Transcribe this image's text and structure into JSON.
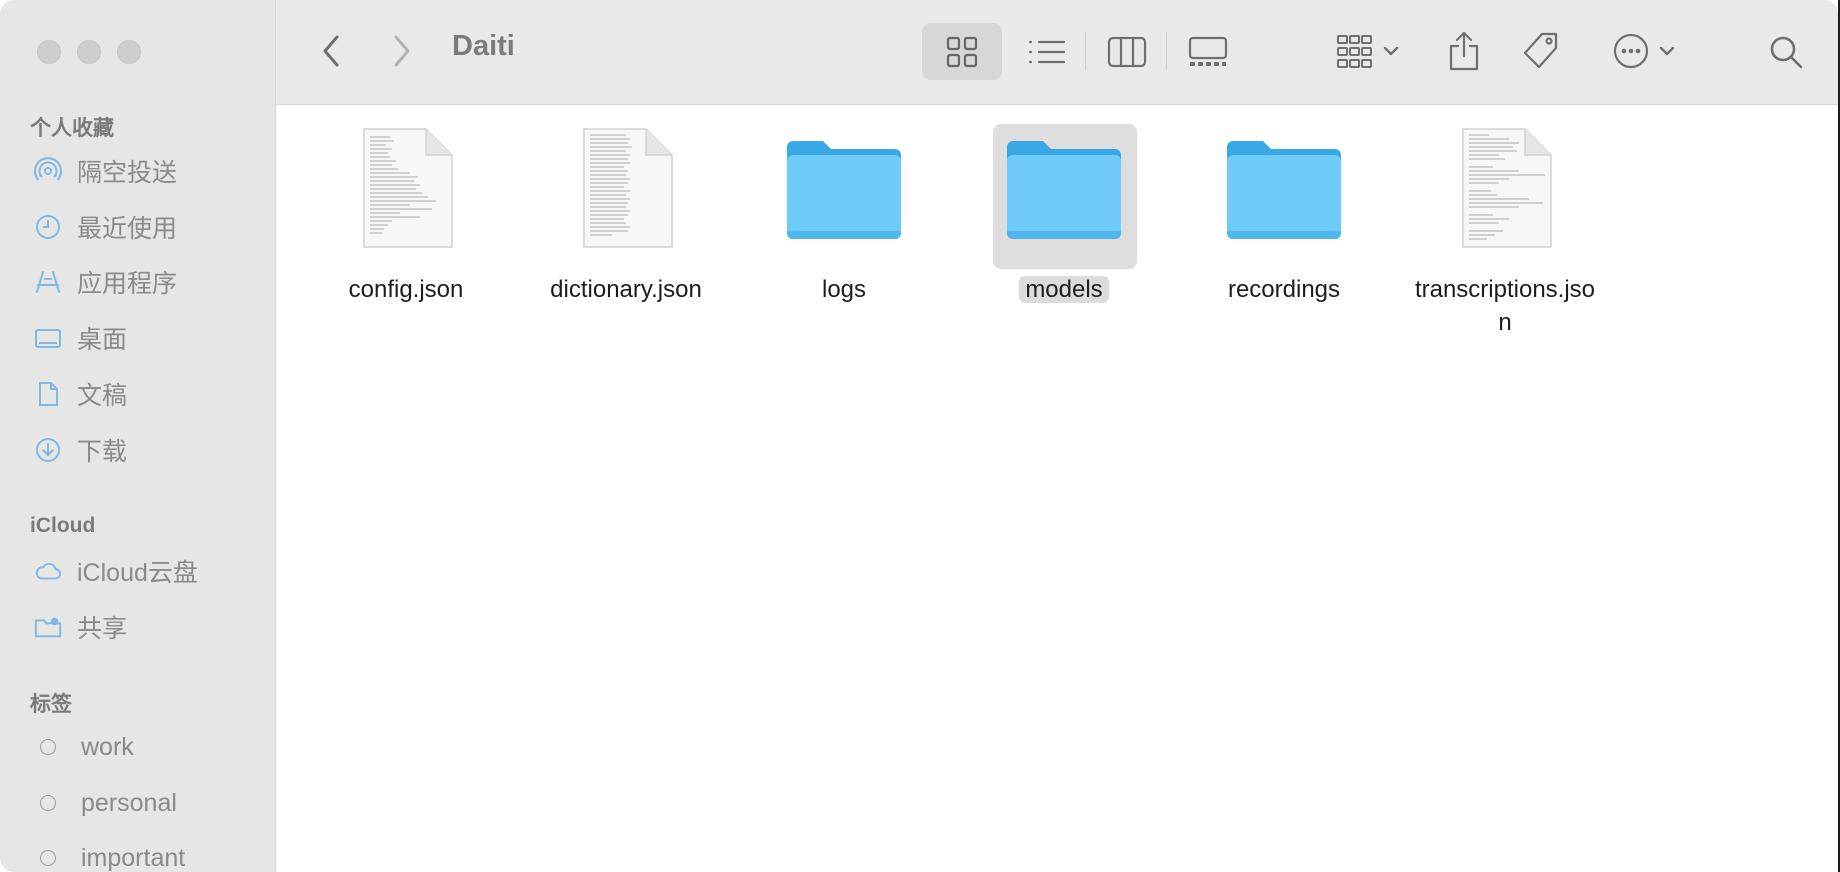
{
  "window": {
    "title": "Daiti"
  },
  "sidebar": {
    "favorites_title": "个人收藏",
    "favorites": [
      {
        "label": "隔空投送",
        "icon": "airdrop-icon"
      },
      {
        "label": "最近使用",
        "icon": "clock-icon"
      },
      {
        "label": "应用程序",
        "icon": "applications-icon"
      },
      {
        "label": "桌面",
        "icon": "desktop-icon"
      },
      {
        "label": "文稿",
        "icon": "document-icon"
      },
      {
        "label": "下载",
        "icon": "download-icon"
      }
    ],
    "icloud_title": "iCloud",
    "icloud": [
      {
        "label": "iCloud云盘",
        "icon": "cloud-icon"
      },
      {
        "label": "共享",
        "icon": "shared-folder-icon"
      }
    ],
    "tags_title": "标签",
    "tags": [
      {
        "label": "work"
      },
      {
        "label": "personal"
      },
      {
        "label": "important"
      }
    ]
  },
  "files": [
    {
      "name": "config.json",
      "type": "document"
    },
    {
      "name": "dictionary.json",
      "type": "document"
    },
    {
      "name": "logs",
      "type": "folder"
    },
    {
      "name": "models",
      "type": "folder",
      "selected": true
    },
    {
      "name": "recordings",
      "type": "folder"
    },
    {
      "name": "transcriptions.json",
      "label_lines": [
        "transcriptions.jso",
        "n"
      ],
      "type": "document"
    }
  ],
  "colors": {
    "folder": "#6ecbfa",
    "folder_tab": "#3aa7e6",
    "sidebar_icon": "#7fb7e6"
  }
}
